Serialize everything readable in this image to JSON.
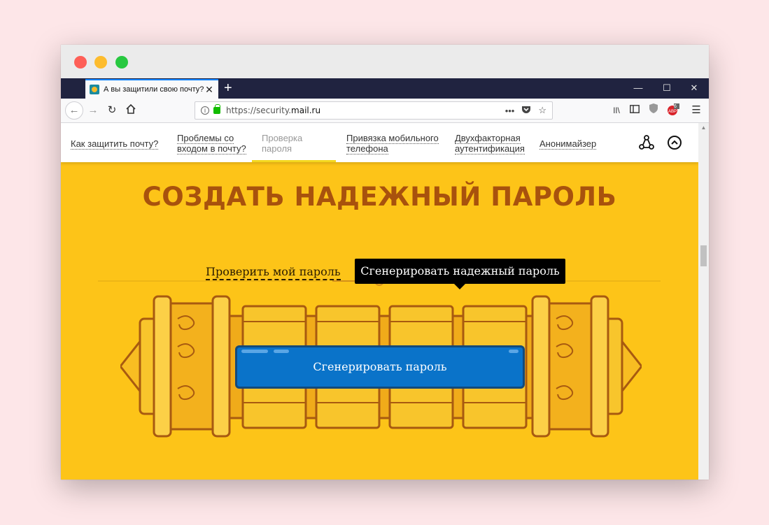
{
  "browser": {
    "tab_title": "А вы защитили свою почту?",
    "tab_close": "✕",
    "new_tab": "+",
    "url_scheme": "https://security.",
    "url_host": "mail.ru",
    "window_min": "—",
    "window_max": "☐",
    "window_close": "✕",
    "url_actions": "•••",
    "adblock_badge": "6"
  },
  "site_nav": {
    "items": [
      {
        "label": "Как защитить почту?"
      },
      {
        "label1": "Проблемы со",
        "label2": "входом в почту?"
      },
      {
        "label1": "Проверка",
        "label2": "пароля"
      },
      {
        "label1": "Привязка мобильного",
        "label2": "телефона"
      },
      {
        "label1": "Двухфакторная",
        "label2": "аутентификация"
      },
      {
        "label": "Анонимайзер"
      }
    ]
  },
  "hero": {
    "title": "СОЗДАТЬ НАДЕЖНЫЙ ПАРОЛЬ",
    "mode_check": "Проверить мой пароль",
    "mode_generate": "Сгенерировать надежный пароль",
    "generate_button": "Сгенерировать пароль"
  },
  "colors": {
    "page_bg": "#fdc418",
    "title": "#a8520d",
    "button": "#0a73c9",
    "device_outline": "#a85a10"
  }
}
